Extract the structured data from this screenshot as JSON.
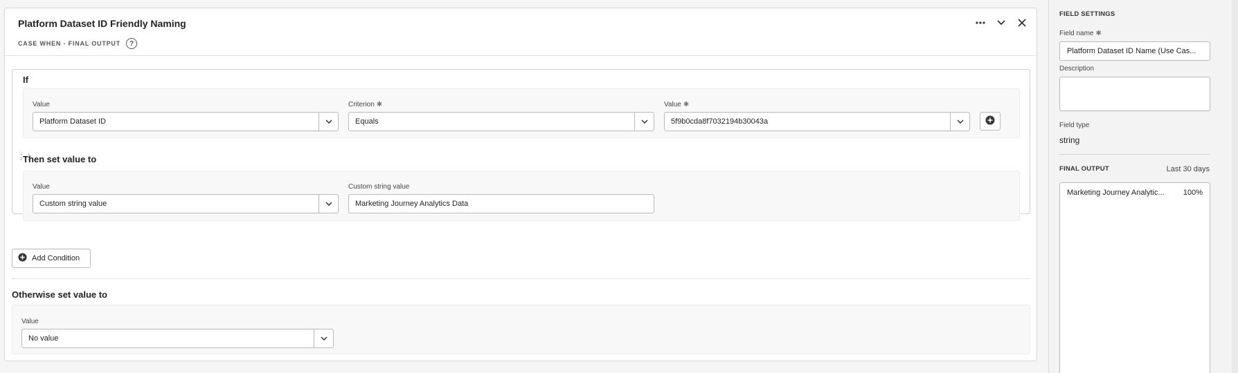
{
  "header": {
    "title": "Platform Dataset ID Friendly Naming",
    "subtitle": "CASE WHEN - FINAL OUTPUT",
    "help_glyph": "?",
    "icons": [
      "more-icon",
      "chevron-down-icon",
      "close-icon"
    ]
  },
  "if_section": {
    "label": "If",
    "condition": {
      "value_label": "Value",
      "value_selected": "Platform Dataset ID",
      "criterion_label": "Criterion",
      "criterion_selected": "Equals",
      "value2_label": "Value",
      "value2_selected": "5f9b0cda8f7032194b30043a"
    },
    "then_label": "Then set value to",
    "then": {
      "value_label": "Value",
      "value_selected": "Custom string value",
      "custom_label": "Custom string value",
      "custom_value": "Marketing Journey Analytics Data"
    }
  },
  "add_condition_label": "Add Condition",
  "otherwise": {
    "label": "Otherwise set value to",
    "value_label": "Value",
    "value_selected": "No value"
  },
  "sidebar": {
    "heading": "FIELD SETTINGS",
    "field_name_label": "Field name",
    "field_name_value": "Platform Dataset ID Name (Use Cas...",
    "description_label": "Description",
    "description_value": "",
    "field_type_label": "Field type",
    "field_type_value": "string",
    "final_output_label": "FINAL OUTPUT",
    "final_output_range": "Last 30 days",
    "output_rows": [
      {
        "label": "Marketing Journey Analytic...",
        "pct": "100%"
      }
    ]
  },
  "colors": {
    "accent": "#222222",
    "border": "#b9b9b9",
    "panel": "#f8f8f8"
  }
}
